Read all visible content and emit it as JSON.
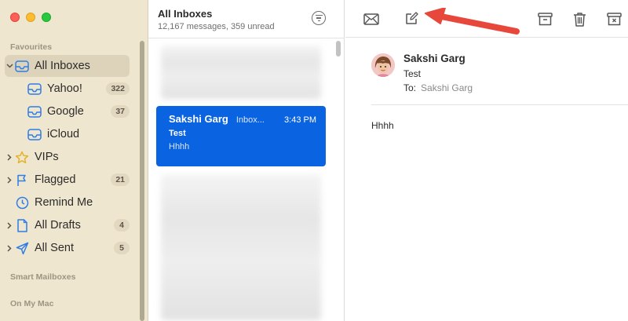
{
  "sidebar": {
    "sections": {
      "favourites": "Favourites",
      "smart_mailboxes": "Smart Mailboxes",
      "on_my_mac": "On My Mac"
    },
    "items": [
      {
        "label": "All Inboxes",
        "badge": ""
      },
      {
        "label": "Yahoo!",
        "badge": "322"
      },
      {
        "label": "Google",
        "badge": "37"
      },
      {
        "label": "iCloud",
        "badge": ""
      },
      {
        "label": "VIPs",
        "badge": ""
      },
      {
        "label": "Flagged",
        "badge": "21"
      },
      {
        "label": "Remind Me",
        "badge": ""
      },
      {
        "label": "All Drafts",
        "badge": "4"
      },
      {
        "label": "All Sent",
        "badge": "5"
      }
    ]
  },
  "list": {
    "title": "All Inboxes",
    "subtitle": "12,167 messages, 359 unread",
    "selected_message": {
      "sender": "Sakshi Garg",
      "folder": "Inbox...",
      "time": "3:43 PM",
      "subject": "Test",
      "preview": "Hhhh"
    }
  },
  "toolbar": {
    "icons": [
      "envelope-icon",
      "compose-icon",
      "archive-icon",
      "trash-icon",
      "junk-icon"
    ]
  },
  "reading": {
    "sender": "Sakshi Garg",
    "subject": "Test",
    "to_label": "To:",
    "to_name": "Sakshi Garg",
    "body": "Hhhh"
  },
  "colors": {
    "sidebar_bg": "#efe6cf",
    "selected_message": "#0a63e0",
    "annotation_arrow": "#e8473b"
  }
}
